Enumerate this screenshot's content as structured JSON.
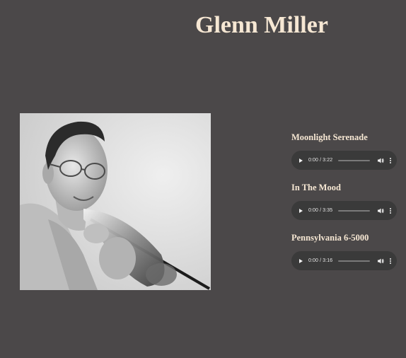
{
  "page": {
    "title": "Glenn Miller",
    "background_color": "#4b4849",
    "title_color": "#f6e7d3"
  },
  "photo": {
    "alt": "Glenn Miller"
  },
  "tracks": [
    {
      "title": "Moonlight Serenade",
      "time": "0:00 / 3:22",
      "progress": 0
    },
    {
      "title": "In The Mood",
      "time": "0:00 / 3:35",
      "progress": 0
    },
    {
      "title": "Pennsylvania 6-5000",
      "time": "0:00 / 3:16",
      "progress": 0
    }
  ],
  "player": {
    "icons": [
      "play-icon",
      "volume-icon",
      "more-options-icon"
    ]
  }
}
